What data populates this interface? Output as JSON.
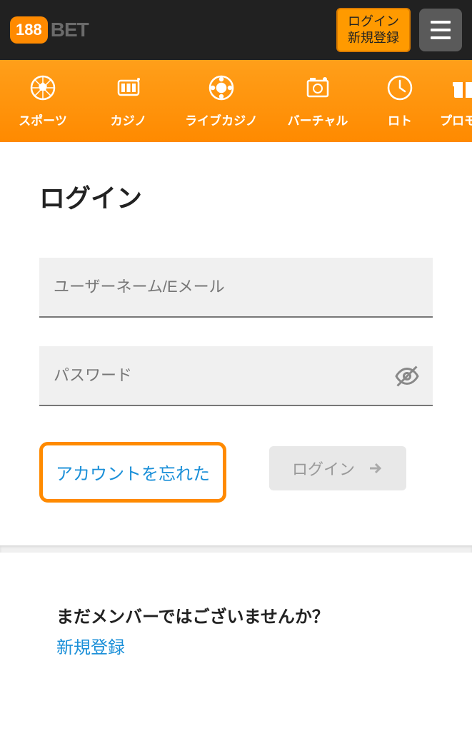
{
  "header": {
    "logo_num": "188",
    "logo_text": "BET",
    "login_label": "ログイン",
    "register_label": "新規登録"
  },
  "nav": {
    "items": [
      {
        "label": "スポーツ",
        "icon": "sports"
      },
      {
        "label": "カジノ",
        "icon": "casino"
      },
      {
        "label": "ライブカジノ",
        "icon": "live-casino"
      },
      {
        "label": "バーチャル",
        "icon": "virtual"
      },
      {
        "label": "ロト",
        "icon": "lotto"
      },
      {
        "label": "プロモー",
        "icon": "promo"
      }
    ]
  },
  "page": {
    "title": "ログイン",
    "username_placeholder": "ユーザーネーム/Eメール",
    "password_placeholder": "パスワード",
    "forgot_label": "アカウントを忘れた",
    "login_button": "ログイン"
  },
  "signup": {
    "prompt": "まだメンバーではございませんか？",
    "link": "新規登録"
  }
}
